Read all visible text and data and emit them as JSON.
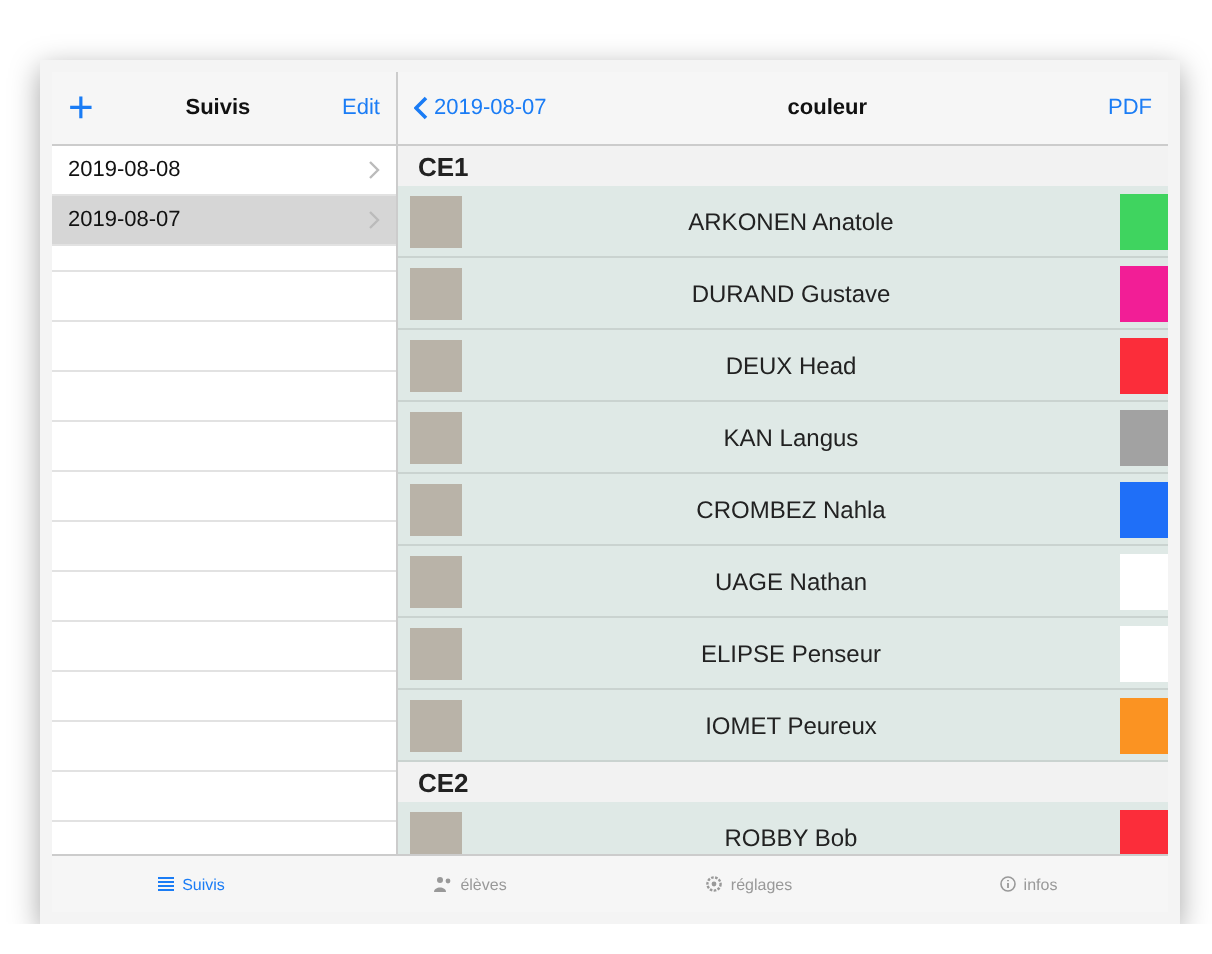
{
  "sidebar": {
    "title": "Suivis",
    "add_button": "+",
    "edit_button": "Edit",
    "items": [
      {
        "label": "2019-08-08",
        "selected": false
      },
      {
        "label": "2019-08-07",
        "selected": true
      }
    ]
  },
  "detail": {
    "back_button": "2019-08-07",
    "title": "couleur",
    "pdf_button": "PDF",
    "sections": [
      {
        "title": "CE1",
        "students": [
          {
            "name": "ARKONEN Anatole",
            "color": "#3fd45f"
          },
          {
            "name": "DURAND Gustave",
            "color": "#f21e96"
          },
          {
            "name": "DEUX Head",
            "color": "#fb2d3a"
          },
          {
            "name": "KAN Langus",
            "color": "#a2a2a2"
          },
          {
            "name": "CROMBEZ Nahla",
            "color": "#1f6ff8"
          },
          {
            "name": "UAGE Nathan",
            "color": "#ffffff"
          },
          {
            "name": "ELIPSE Penseur",
            "color": "#ffffff"
          },
          {
            "name": "IOMET Peureux",
            "color": "#fb9322"
          }
        ]
      },
      {
        "title": "CE2",
        "students": [
          {
            "name": "ROBBY Bob",
            "color": "#fb2d3a"
          }
        ]
      }
    ]
  },
  "tab_bar": [
    {
      "label": "Suivis",
      "selected": true
    },
    {
      "label": "élèves",
      "selected": false
    },
    {
      "label": "réglages",
      "selected": false
    },
    {
      "label": "infos",
      "selected": false
    }
  ]
}
